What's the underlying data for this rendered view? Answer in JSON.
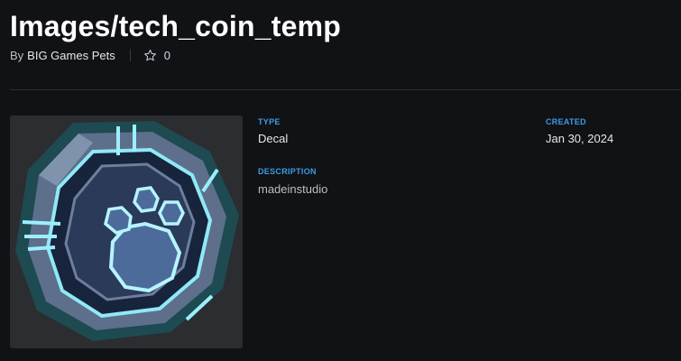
{
  "asset": {
    "title": "Images/tech_coin_temp",
    "by_prefix": "By",
    "creator": "BIG Games Pets",
    "favorite_count": "0"
  },
  "details": {
    "type_label": "TYPE",
    "type_value": "Decal",
    "created_label": "CREATED",
    "created_value": "Jan 30, 2024",
    "description_label": "DESCRIPTION",
    "description_value": "madeinstudio"
  },
  "icons": {
    "favorite": "star-outline-icon"
  },
  "colors": {
    "background": "#111216",
    "label_accent": "#3d9ce4",
    "thumbnail_bg": "#2b2d30"
  }
}
